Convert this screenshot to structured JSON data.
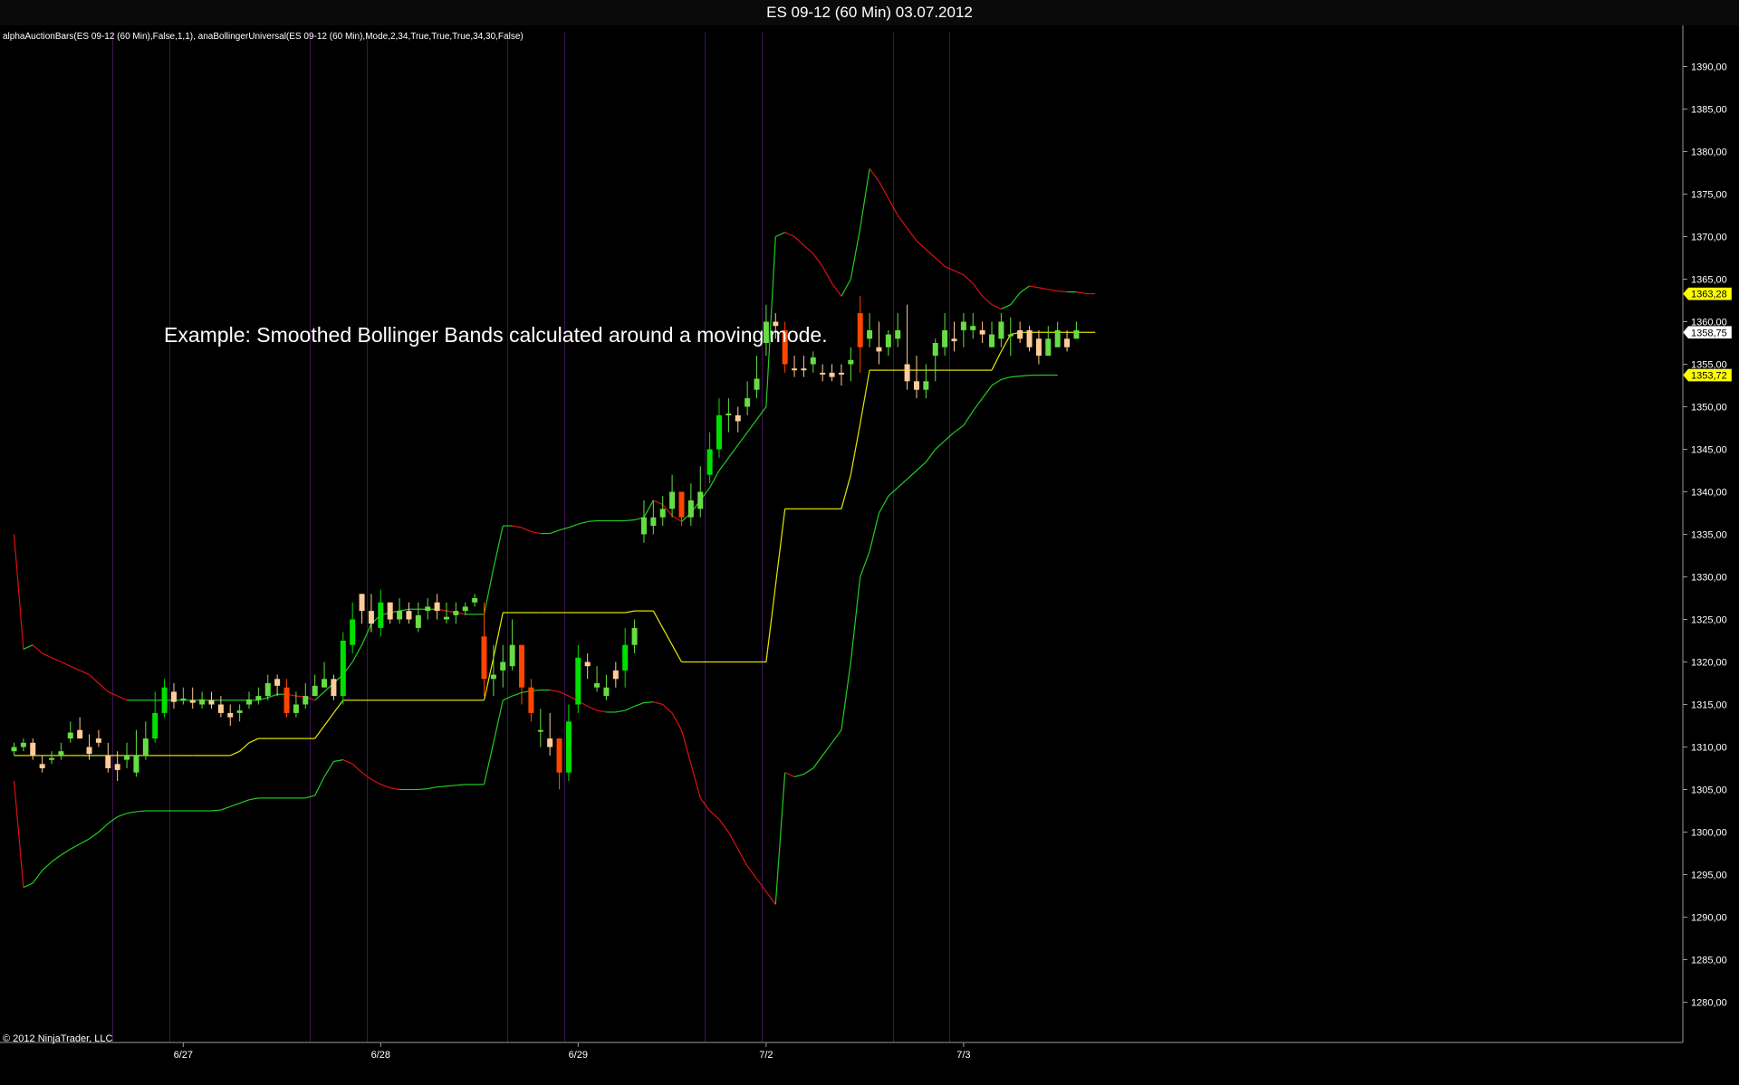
{
  "window": {
    "title": "ES 09-12 (60 Min)  03.07.2012"
  },
  "chart": {
    "indicator_label": "alphaAuctionBars(ES 09-12 (60 Min),False,1,1), anaBollingerUniversal(ES 09-12 (60 Min),Mode,2,34,True,True,True,34,30,False)",
    "annotation": "Example: Smoothed Bollinger Bands calculated around a moving mode.",
    "copyright": "© 2012 NinjaTrader, LLC",
    "price_markers": [
      {
        "label": "1363,28",
        "value": 1363.28,
        "color": "#ffff00"
      },
      {
        "label": "1358,75",
        "value": 1358.75,
        "color": "#ffffff"
      },
      {
        "label": "1353,72",
        "value": 1353.72,
        "color": "#ffff00"
      }
    ]
  },
  "chart_data": {
    "type": "candlestick",
    "title": "ES 09-12 (60 Min)  03.07.2012",
    "x_tick_labels": [
      "6/27",
      "6/28",
      "6/29",
      "7/2",
      "7/3"
    ],
    "x_tick_bars": [
      18,
      39,
      60,
      80,
      101
    ],
    "day_separators": [
      10.5,
      16.5,
      31.5,
      37.5,
      52.5,
      58.5,
      73.5,
      79.5,
      93.5,
      99.5
    ],
    "y_ticks": [
      "1280,00",
      "1285,00",
      "1290,00",
      "1295,00",
      "1300,00",
      "1305,00",
      "1310,00",
      "1315,00",
      "1320,00",
      "1325,00",
      "1330,00",
      "1335,00",
      "1340,00",
      "1345,00",
      "1350,00",
      "1355,00",
      "1360,00",
      "1365,00",
      "1370,00",
      "1375,00",
      "1380,00",
      "1385,00",
      "1390,00"
    ],
    "ylim": [
      1275.5,
      1393.0
    ],
    "grid": false,
    "colors": {
      "up": "#00e000",
      "down": "#ff4500",
      "up_small": "#66dd44",
      "down_small": "#ffcc99",
      "upper_band_up": "#22cc22",
      "upper_band_down": "#dd1111",
      "mode_line": "#e8e800",
      "lower_band_up": "#22cc22",
      "lower_band_down": "#dd1111",
      "separator": "#3c1450"
    },
    "candles": {
      "open": [
        1309.5,
        1310,
        1310.5,
        1308,
        1308.5,
        1309,
        1311,
        1312,
        1310,
        1311,
        1309,
        1308,
        1308.5,
        1307,
        1309,
        1311,
        1314,
        1316.5,
        1315.5,
        1315.5,
        1315,
        1315.5,
        1315,
        1314,
        1314,
        1315,
        1315.5,
        1316,
        1318,
        1317,
        1314,
        1315,
        1316,
        1317,
        1318,
        1316,
        1322,
        1328,
        1326,
        1324,
        1327,
        1325,
        1326,
        1324,
        1326,
        1327,
        1325,
        1325.5,
        1326,
        1327,
        1323,
        1318,
        1319,
        1319.5,
        1322,
        1317,
        1312,
        1311,
        1311,
        1307,
        1315,
        1320,
        1317,
        1316,
        1319,
        1319,
        1322,
        1335,
        1336,
        1337,
        1338,
        1340,
        1337,
        1338,
        1342,
        1345,
        1349,
        1349,
        1350,
        1352,
        1357.5,
        1360,
        1359,
        1354.5,
        1354.5,
        1355,
        1354,
        1354,
        1354,
        1355,
        1361,
        1358,
        1357,
        1357,
        1358,
        1355,
        1353,
        1352,
        1356,
        1357,
        1358,
        1359,
        1359,
        1359,
        1357,
        1358,
        1358.5,
        1359,
        1359,
        1358,
        1356,
        1357,
        1358,
        1358
      ],
      "close": [
        1310,
        1310.5,
        1309,
        1307.5,
        1308.7,
        1309.5,
        1311.7,
        1311,
        1309.2,
        1310.5,
        1307.5,
        1307.3,
        1309,
        1309,
        1311,
        1314,
        1317,
        1315.3,
        1315.7,
        1315.2,
        1315.6,
        1315,
        1314,
        1313.5,
        1314.3,
        1315.6,
        1316,
        1317.5,
        1317.2,
        1314,
        1315,
        1316,
        1317.2,
        1318,
        1316,
        1322.5,
        1325,
        1326,
        1324.5,
        1327,
        1325,
        1326,
        1325,
        1325.5,
        1326.5,
        1326,
        1325.3,
        1326,
        1326.5,
        1327.5,
        1318,
        1318.5,
        1320,
        1322,
        1317,
        1314,
        1312,
        1310,
        1307,
        1313,
        1320.5,
        1319.5,
        1317.5,
        1317,
        1318,
        1322,
        1324,
        1337,
        1337,
        1338,
        1340,
        1337,
        1339,
        1340,
        1345,
        1349,
        1349.2,
        1348.3,
        1351,
        1353.3,
        1360,
        1359.5,
        1355,
        1354.4,
        1354.3,
        1355.8,
        1353.8,
        1353.5,
        1353.8,
        1355.5,
        1357,
        1359,
        1356.5,
        1358.5,
        1359,
        1353,
        1352,
        1353,
        1357.5,
        1359,
        1357.7,
        1360,
        1359.5,
        1358.5,
        1358.5,
        1360,
        1358.5,
        1358,
        1357,
        1356,
        1358,
        1359,
        1357,
        1359
      ],
      "high": [
        1310.5,
        1311,
        1311,
        1309,
        1309.5,
        1310.5,
        1313,
        1313.5,
        1311.5,
        1312,
        1310.5,
        1309.5,
        1310.5,
        1312,
        1313,
        1316.5,
        1318,
        1317.5,
        1317,
        1317,
        1316.5,
        1316.5,
        1316,
        1315,
        1315,
        1316.5,
        1317,
        1318.5,
        1318.5,
        1318,
        1316.5,
        1317.5,
        1318.5,
        1320,
        1318.5,
        1323.5,
        1327,
        1328,
        1328,
        1328.5,
        1327,
        1327.5,
        1327,
        1327,
        1327.5,
        1328,
        1327,
        1327,
        1327,
        1328,
        1327,
        1322,
        1322,
        1325,
        1320,
        1318,
        1314.5,
        1314,
        1310,
        1315,
        1322,
        1321,
        1319.5,
        1318.5,
        1320,
        1324,
        1325,
        1339,
        1339,
        1339.5,
        1342,
        1340,
        1341,
        1343,
        1347,
        1351,
        1351,
        1350,
        1353,
        1356,
        1362,
        1361,
        1360,
        1356,
        1356,
        1356.5,
        1355,
        1355,
        1355,
        1357,
        1363,
        1361,
        1360,
        1359,
        1361,
        1362,
        1356,
        1355,
        1358,
        1361,
        1360,
        1361,
        1361,
        1360,
        1360,
        1361,
        1360.5,
        1360,
        1359.5,
        1359,
        1359.5,
        1360,
        1359,
        1360
      ],
      "low": [
        1309,
        1309.5,
        1308.5,
        1307,
        1308,
        1308.5,
        1310.5,
        1311,
        1308.5,
        1310,
        1307,
        1306,
        1307.5,
        1306.5,
        1308.5,
        1310.5,
        1313.5,
        1314.5,
        1315,
        1314.5,
        1314.5,
        1314.5,
        1313.5,
        1312.5,
        1313,
        1314.5,
        1315,
        1315.5,
        1316,
        1313.5,
        1313.5,
        1314.5,
        1316,
        1317,
        1315.5,
        1315,
        1321,
        1324.5,
        1323.5,
        1323,
        1324.5,
        1324.5,
        1324.5,
        1323.5,
        1325,
        1325,
        1324.5,
        1324.5,
        1325.5,
        1326.5,
        1316,
        1316,
        1317,
        1319,
        1315,
        1313,
        1310,
        1309,
        1305,
        1306,
        1314,
        1318,
        1316.5,
        1315.5,
        1317,
        1317,
        1321,
        1334,
        1335,
        1336,
        1337,
        1336,
        1336,
        1337,
        1341,
        1344,
        1347,
        1347,
        1349,
        1351,
        1356,
        1358,
        1354,
        1353.5,
        1353.5,
        1354,
        1353,
        1353,
        1352.5,
        1353,
        1354,
        1357,
        1355,
        1356,
        1357,
        1352,
        1351,
        1351,
        1353,
        1356,
        1356.5,
        1357,
        1358,
        1357.5,
        1357,
        1357,
        1356,
        1357.5,
        1356.5,
        1355,
        1356,
        1357,
        1356.5,
        1358
      ]
    },
    "upper_band": [
      1335,
      1321.5,
      1322,
      1321,
      1320.5,
      1320,
      1319.5,
      1319,
      1318.5,
      1317.5,
      1316.5,
      1316,
      1315.5,
      1315.5,
      1315.5,
      1315.5,
      1315.5,
      1315.5,
      1315.5,
      1315.5,
      1315.5,
      1315.5,
      1315.5,
      1315.5,
      1315.5,
      1315.5,
      1315.5,
      1315.8,
      1316.2,
      1316.2,
      1316,
      1315.9,
      1315.5,
      1316.5,
      1317.5,
      1318.5,
      1320,
      1322,
      1324.5,
      1325.5,
      1325.8,
      1326,
      1326.2,
      1326.2,
      1326.2,
      1326.2,
      1326,
      1325.8,
      1325.6,
      1325.6,
      1325.6,
      1331,
      1336,
      1336,
      1335.8,
      1335.3,
      1335.1,
      1335.1,
      1335.5,
      1335.8,
      1336.2,
      1336.5,
      1336.6,
      1336.6,
      1336.6,
      1336.6,
      1336.7,
      1337,
      1339,
      1338.5,
      1337.2,
      1336.5,
      1337.5,
      1339,
      1340.5,
      1342.5,
      1344,
      1345.5,
      1347,
      1348.5,
      1350,
      1370,
      1370.5,
      1370,
      1369,
      1368,
      1366.5,
      1364.5,
      1363,
      1365,
      1371,
      1378,
      1376.5,
      1374.5,
      1372.5,
      1371,
      1369.5,
      1368.5,
      1367.5,
      1366.5,
      1366,
      1365.5,
      1364.5,
      1363,
      1362,
      1361.5,
      1362,
      1363.4,
      1364.2,
      1364,
      1363.8,
      1363.6,
      1363.5,
      1363.5,
      1363.3,
      1363.28
    ],
    "mode_line": [
      1309,
      1309,
      1309,
      1309,
      1309,
      1309,
      1309,
      1309,
      1309,
      1309,
      1309,
      1309,
      1309,
      1309,
      1309,
      1309,
      1309,
      1309,
      1309,
      1309,
      1309,
      1309,
      1309,
      1309,
      1309.5,
      1310.5,
      1311,
      1311,
      1311,
      1311,
      1311,
      1311,
      1311,
      1312.5,
      1314,
      1315.5,
      1315.5,
      1315.5,
      1315.5,
      1315.5,
      1315.5,
      1315.5,
      1315.5,
      1315.5,
      1315.5,
      1315.5,
      1315.5,
      1315.5,
      1315.5,
      1315.5,
      1315.5,
      1320.5,
      1325.8,
      1325.8,
      1325.8,
      1325.8,
      1325.8,
      1325.8,
      1325.8,
      1325.8,
      1325.8,
      1325.8,
      1325.8,
      1325.8,
      1325.8,
      1325.8,
      1326,
      1326,
      1326,
      1324,
      1322,
      1320,
      1320,
      1320,
      1320,
      1320,
      1320,
      1320,
      1320,
      1320,
      1320,
      1329,
      1338,
      1338,
      1338,
      1338,
      1338,
      1338,
      1338,
      1342,
      1348,
      1354.3,
      1354.3,
      1354.3,
      1354.3,
      1354.3,
      1354.3,
      1354.3,
      1354.3,
      1354.3,
      1354.3,
      1354.3,
      1354.3,
      1354.3,
      1354.3,
      1356.5,
      1358.5,
      1358.75,
      1358.75,
      1358.75,
      1358.75,
      1358.75,
      1358.75,
      1358.75,
      1358.75,
      1358.75
    ],
    "lower_band": [
      1306,
      1293.5,
      1294,
      1295.5,
      1296.5,
      1297.3,
      1298,
      1298.6,
      1299.2,
      1300,
      1301,
      1301.8,
      1302.2,
      1302.4,
      1302.5,
      1302.5,
      1302.5,
      1302.5,
      1302.5,
      1302.5,
      1302.5,
      1302.5,
      1302.6,
      1303,
      1303.4,
      1303.8,
      1304,
      1304,
      1304,
      1304,
      1304,
      1304,
      1304.3,
      1306.5,
      1308.3,
      1308.5,
      1308,
      1307,
      1306.2,
      1305.6,
      1305.2,
      1305,
      1305,
      1305,
      1305.1,
      1305.3,
      1305.4,
      1305.5,
      1305.6,
      1305.6,
      1305.6,
      1310.5,
      1315.5,
      1316,
      1316.4,
      1316.6,
      1316.7,
      1316.7,
      1316.5,
      1316,
      1315.4,
      1314.8,
      1314.3,
      1314.1,
      1314.1,
      1314.3,
      1314.8,
      1315.2,
      1315.3,
      1315,
      1314,
      1312,
      1308,
      1304,
      1302.5,
      1301.5,
      1300,
      1298,
      1296,
      1294.5,
      1293,
      1291.5,
      1307,
      1306.5,
      1306.8,
      1307.5,
      1309,
      1310.5,
      1312,
      1320,
      1330,
      1333,
      1337.5,
      1339.5,
      1340.5,
      1341.5,
      1342.5,
      1343.5,
      1345,
      1346,
      1347,
      1347.8,
      1349.5,
      1351,
      1352.5,
      1353.2,
      1353.5,
      1353.6,
      1353.7,
      1353.72,
      1353.72,
      1353.72
    ]
  }
}
